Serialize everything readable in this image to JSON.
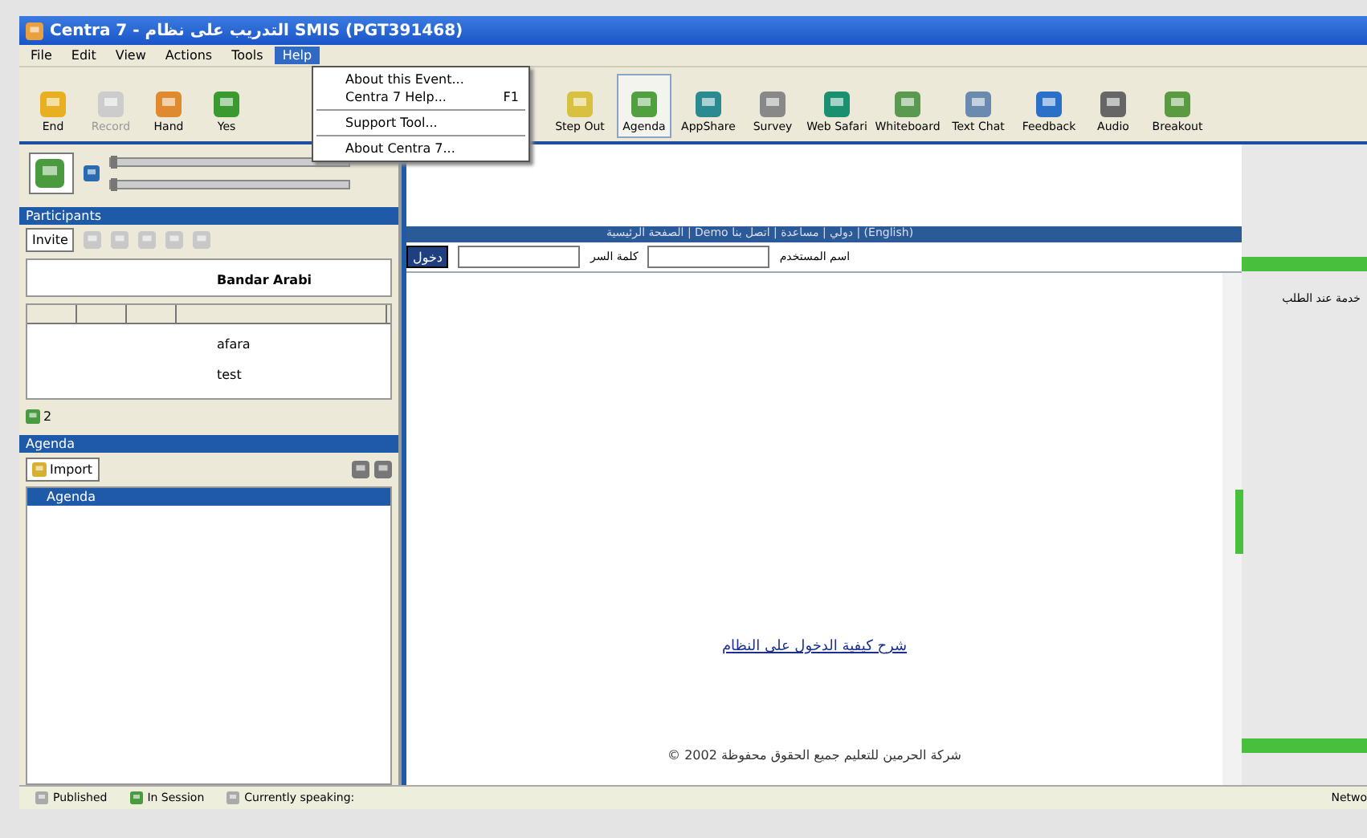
{
  "window": {
    "title": "Centra 7 - التدريب على نظام SMIS (PGT391468)"
  },
  "menu_bar": [
    {
      "label": "File",
      "selected": false
    },
    {
      "label": "Edit",
      "selected": false
    },
    {
      "label": "View",
      "selected": false
    },
    {
      "label": "Actions",
      "selected": false
    },
    {
      "label": "Tools",
      "selected": false
    },
    {
      "label": "Help",
      "selected": true
    }
  ],
  "help_menu": [
    {
      "kind": "item",
      "label": "About this Event..."
    },
    {
      "kind": "item",
      "label": "Centra 7 Help...",
      "shortcut": "F1"
    },
    {
      "kind": "separator"
    },
    {
      "kind": "item",
      "label": "Support Tool..."
    },
    {
      "kind": "separator"
    },
    {
      "kind": "item",
      "label": "About Centra 7..."
    }
  ],
  "volume_sliders": [
    {
      "level": 0
    },
    {
      "level": 0
    }
  ],
  "toolbar": [
    {
      "kind": "button",
      "label": "End",
      "disabled": false,
      "selected": false
    },
    {
      "kind": "button",
      "label": "Record",
      "disabled": true,
      "selected": false
    },
    {
      "kind": "button",
      "label": "Hand",
      "disabled": false,
      "selected": false
    },
    {
      "kind": "button",
      "label": "Yes",
      "disabled": false,
      "selected": false
    },
    {
      "kind": "hidden"
    },
    {
      "kind": "button",
      "label": "Step Out",
      "disabled": false,
      "selected": false
    },
    {
      "kind": "button",
      "label": "Agenda",
      "disabled": false,
      "selected": true
    },
    {
      "kind": "button",
      "label": "AppShare",
      "disabled": false,
      "selected": false
    },
    {
      "kind": "button",
      "label": "Survey",
      "disabled": false,
      "selected": false
    },
    {
      "kind": "button",
      "label": "Web Safari",
      "disabled": false,
      "selected": false
    },
    {
      "kind": "button",
      "label": "Whiteboard",
      "disabled": false,
      "selected": false
    },
    {
      "kind": "button",
      "label": "Text Chat",
      "disabled": false,
      "selected": false
    },
    {
      "kind": "button",
      "label": "Feedback",
      "disabled": false,
      "selected": false
    },
    {
      "kind": "button",
      "label": "Audio",
      "disabled": false,
      "selected": false
    },
    {
      "kind": "button",
      "label": "Breakout",
      "disabled": false,
      "selected": false
    }
  ],
  "participants": {
    "title": "Participants",
    "invite": "Invite",
    "speaker": "Bandar Arabi",
    "people": [
      "afara",
      "test"
    ],
    "count": "2"
  },
  "agenda": {
    "title": "Agenda",
    "import": "Import",
    "items": [
      {
        "label": "Agenda",
        "selected": true
      }
    ]
  },
  "web_page": {
    "nav": "الصفحة الرئيسية | Demo دولي | مساعدة | اتصل بنا | (English)",
    "username_label": "اسم المستخدم",
    "password_label": "كلمة السر",
    "login_button": "دخول",
    "link": "شرح كيفية الدخول على النظام",
    "copyright": "© 2002 شركة الحرمين للتعليم جميع الحقوق محفوظة"
  },
  "side_panel": {
    "text": "خدمة عند الطلب"
  },
  "status_bar": [
    {
      "label": "Published"
    },
    {
      "label": "In Session"
    },
    {
      "label": "Currently speaking:"
    },
    {
      "label": "Netwo"
    }
  ]
}
